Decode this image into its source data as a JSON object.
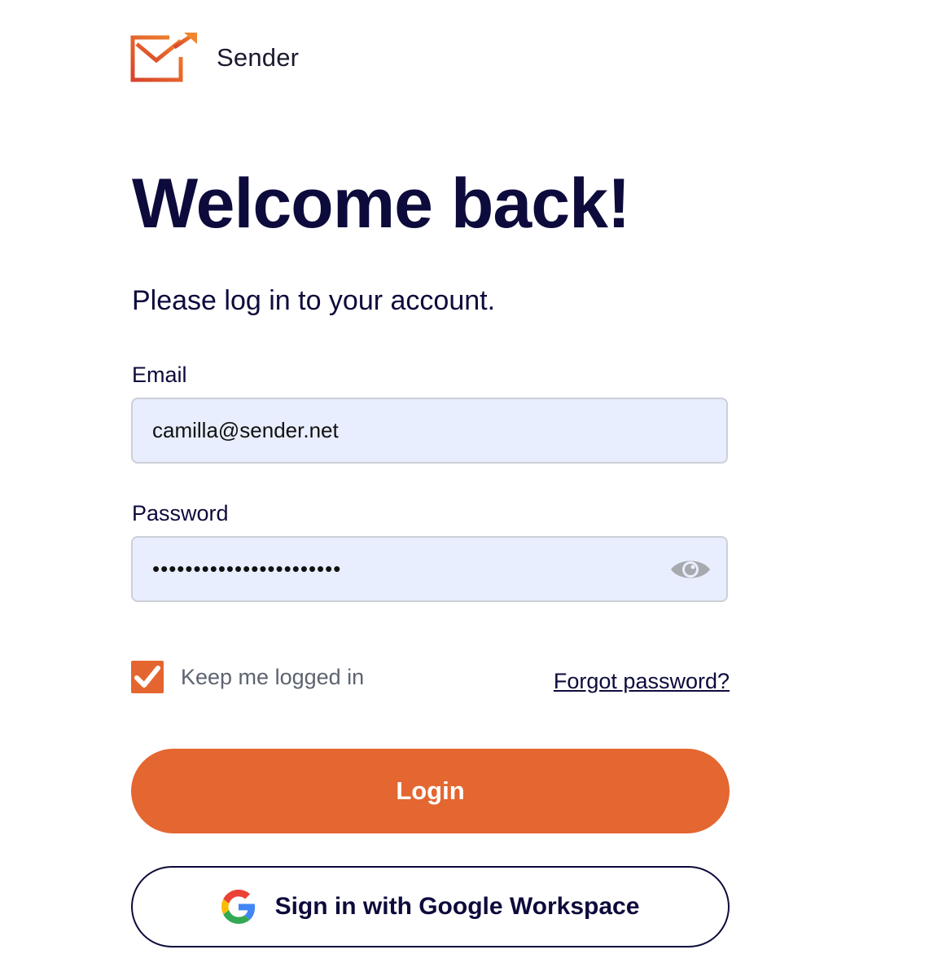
{
  "brand": {
    "name": "Sender",
    "logo_icon": "envelope-arrow-icon",
    "color": "#e4652f"
  },
  "heading": {
    "title": "Welcome back!",
    "subtitle": "Please log in to your account."
  },
  "form": {
    "email": {
      "label": "Email",
      "value": "camilla@sender.net"
    },
    "password": {
      "label": "Password",
      "value": "•••••••••••••••••••••••",
      "toggle_icon": "eye-icon"
    },
    "keep_logged_in": {
      "label": "Keep me logged in",
      "checked": true
    },
    "forgot_password": "Forgot password?"
  },
  "actions": {
    "login_label": "Login",
    "google_label": "Sign in with Google Workspace",
    "google_icon": "google-g-icon"
  },
  "colors": {
    "accent": "#e4652f",
    "text_dark": "#0d0b3c",
    "input_bg": "#e8eefd"
  }
}
